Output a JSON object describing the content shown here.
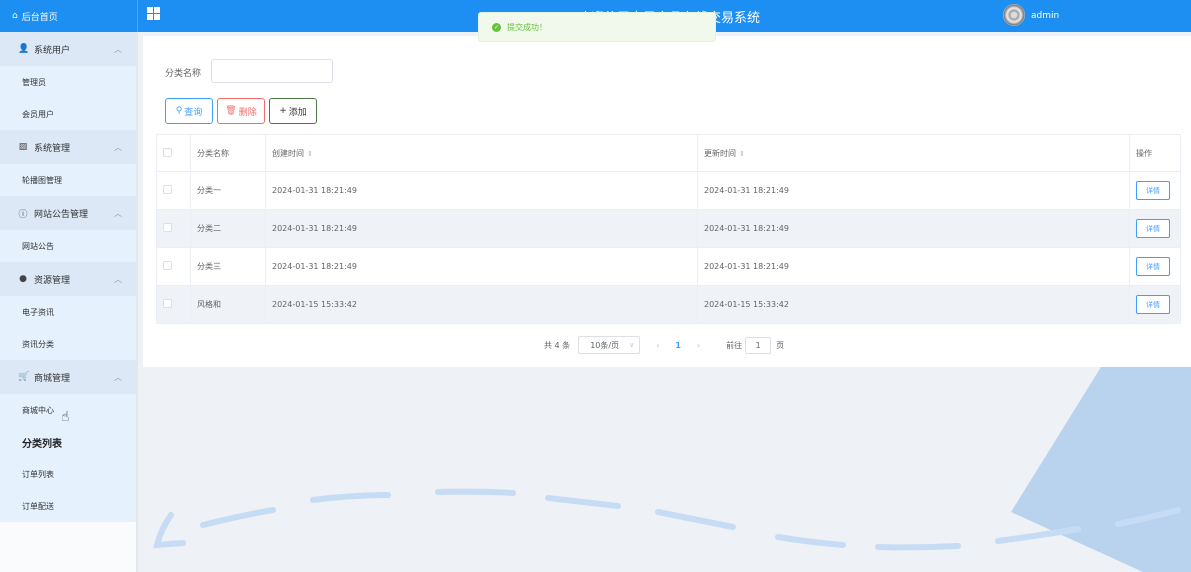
{
  "header": {
    "home_label": "后台首页",
    "site_title": "欢迎使用电子产品在线交易系统",
    "username": "admin"
  },
  "toast": {
    "message": "提交成功！",
    "color": "#67c23a"
  },
  "sidebar": {
    "groups": [
      {
        "title": "系统用户",
        "icon": "user-icon",
        "items": [
          "管理员",
          "会员用户"
        ]
      },
      {
        "title": "系统管理",
        "icon": "image-icon",
        "items": [
          "轮播图管理"
        ]
      },
      {
        "title": "网站公告管理",
        "icon": "info-icon",
        "items": [
          "网站公告"
        ]
      },
      {
        "title": "资源管理",
        "icon": "location-icon",
        "items": [
          "电子资讯",
          "资讯分类"
        ]
      },
      {
        "title": "商城管理",
        "icon": "cart-icon",
        "items": [
          "商城中心",
          "分类列表",
          "订单列表",
          "订单配送"
        ]
      }
    ],
    "active_item": "分类列表"
  },
  "filter": {
    "label": "分类名称",
    "value": ""
  },
  "buttons": {
    "query": "查询",
    "delete": "删除",
    "add": "添加"
  },
  "table": {
    "columns": [
      "分类名称",
      "创建时间",
      "更新时间",
      "操作"
    ],
    "rows": [
      {
        "name": "分类一",
        "created": "2024-01-31 18:21:49",
        "updated": "2024-01-31 18:21:49",
        "action": "详情"
      },
      {
        "name": "分类二",
        "created": "2024-01-31 18:21:49",
        "updated": "2024-01-31 18:21:49",
        "action": "详情"
      },
      {
        "name": "分类三",
        "created": "2024-01-31 18:21:49",
        "updated": "2024-01-31 18:21:49",
        "action": "详情"
      },
      {
        "name": "风格和",
        "created": "2024-01-15 15:33:42",
        "updated": "2024-01-15 15:33:42",
        "action": "详情"
      }
    ]
  },
  "pagination": {
    "total": "共 4 条",
    "page_size": "10条/页",
    "current_page": "1",
    "goto_label": "前往",
    "goto_value": "1",
    "page_unit": "页"
  },
  "colors": {
    "primary": "#1d8ef2",
    "danger": "#f56c6c",
    "sidebar_active": "#e5f1fd"
  }
}
